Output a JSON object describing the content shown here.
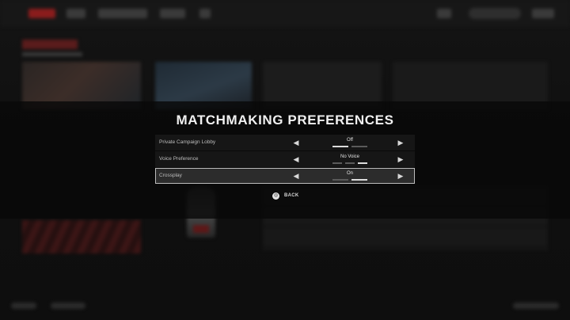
{
  "modal": {
    "title": "MATCHMAKING PREFERENCES",
    "options": [
      {
        "label": "Private Campaign Lobby",
        "value": "Off",
        "pip_count": 2,
        "active_pip": 0,
        "selected": false
      },
      {
        "label": "Voice Preference",
        "value": "No Voice",
        "pip_count": 3,
        "active_pip": 2,
        "selected": false
      },
      {
        "label": "Crossplay",
        "value": "On",
        "pip_count": 2,
        "active_pip": 1,
        "selected": true
      }
    ],
    "back": {
      "icon": "circle-button-icon",
      "icon_glyph": "◎",
      "label": "BACK"
    },
    "arrow_left_glyph": "◀",
    "arrow_right_glyph": "▶"
  },
  "colors": {
    "accent_red": "#8a1c1c",
    "selected_border": "#bdbdbd",
    "text_primary": "#f0f0f0"
  }
}
